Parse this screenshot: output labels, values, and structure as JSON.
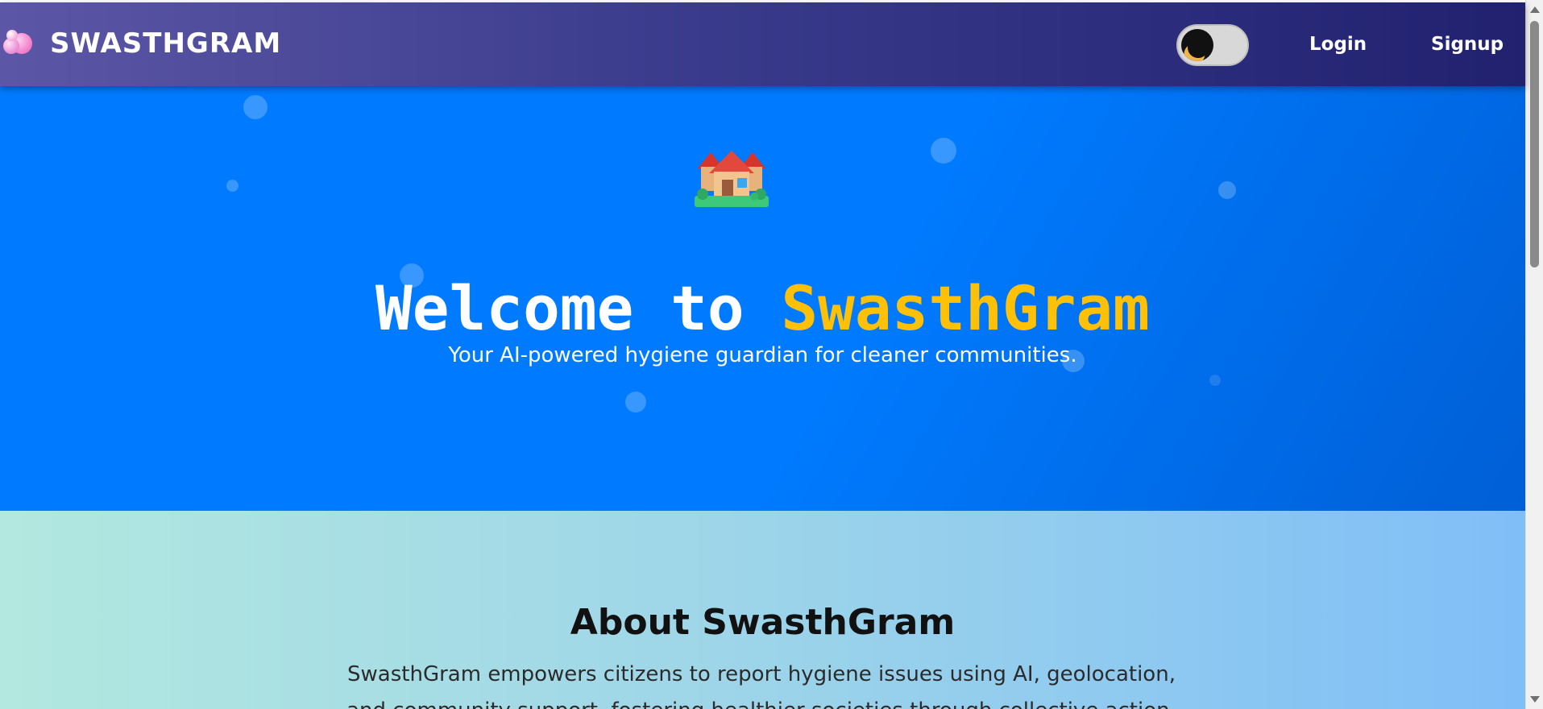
{
  "navbar": {
    "brand_name": "SWASTHGRAM",
    "theme_toggle_state": "dark-mode-off",
    "login_label": "Login",
    "signup_label": "Signup"
  },
  "hero": {
    "icon": "houses-icon",
    "title_prefix": "Welcome to ",
    "title_accent": "SwasthGram",
    "subtitle": "Your AI-powered hygiene guardian for cleaner communities."
  },
  "about": {
    "title": "About SwasthGram",
    "description": "SwasthGram empowers citizens to report hygiene issues using AI, geolocation, and community support, fostering healthier societies through collective action."
  },
  "colors": {
    "navbar_start": "#5c56a6",
    "navbar_end": "#212170",
    "hero_bg": "#007bff",
    "accent": "#ffc107",
    "about_start": "#b2e8df",
    "about_end": "#80bef7"
  }
}
